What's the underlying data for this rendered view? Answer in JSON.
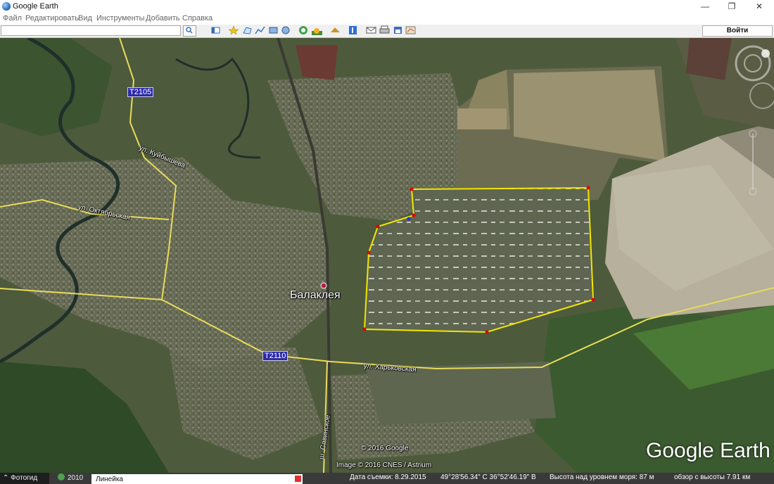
{
  "window": {
    "title": "Google Earth",
    "controls": [
      "—",
      "❐",
      "✕"
    ]
  },
  "menu": [
    "Файл",
    "Редактировать",
    "Вид",
    "Инструменты",
    "Добавить",
    "Справка"
  ],
  "toolbar": {
    "search_value": "",
    "signin_label": "Войти"
  },
  "map": {
    "city_label": "Балаклея",
    "road_labels": {
      "kuibysheva": "ул. Куйбышева",
      "oktyabrskaya": "ул. Октябрьская",
      "kharkovskaya": "ул. Харьковская",
      "savinskoe": "ш. Савинское"
    },
    "shields": [
      "T2105",
      "T2110"
    ],
    "copyright": "© 2016 Google",
    "imagery": "Image © 2016 CNES / Astrium",
    "logo": "Google Earth"
  },
  "status": {
    "tour_label": "Фотогид",
    "year": "2010",
    "ruler_tab": "Линейка",
    "capture_date": "Дата съемки: 8.29.2015",
    "coordinates": "49°28'56.34\" С  36°52'46.19\" В",
    "elevation": "Высота над уровнем моря:   87 м",
    "eye_alt": "обзор с высоты   7.91 км"
  },
  "colors": {
    "polygon": "#f2e600",
    "vertex": "#e00000",
    "road": "#e8dc5a",
    "imagery_bg": "#4e5a3c"
  }
}
